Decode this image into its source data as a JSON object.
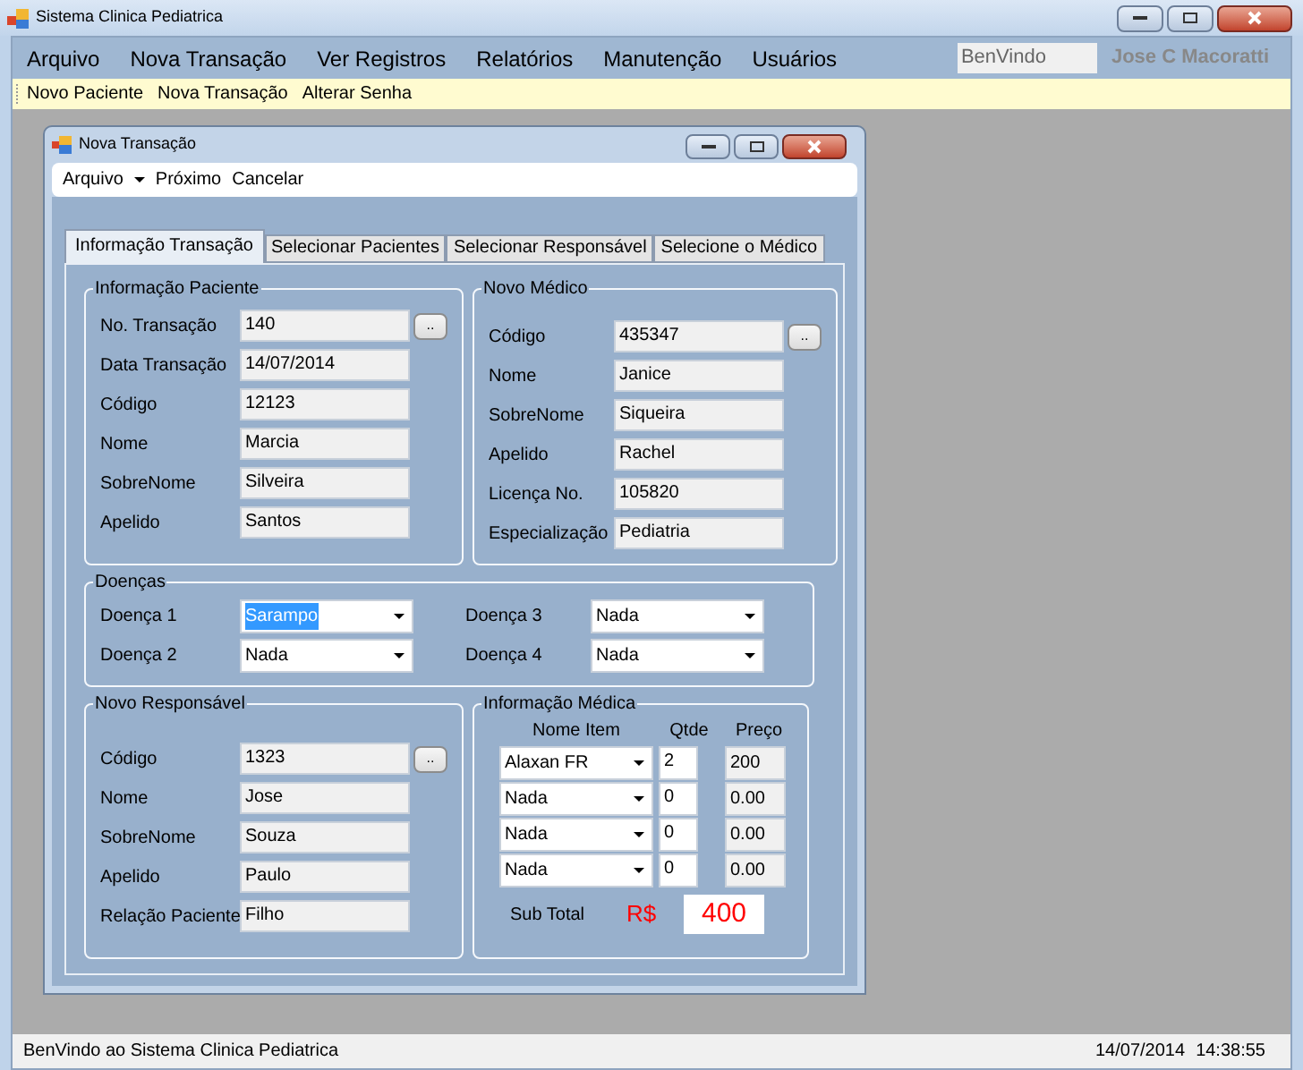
{
  "window": {
    "title": "Sistema Clinica Pediatrica"
  },
  "menu": [
    "Arquivo",
    "Nova Transação",
    "Ver Registros",
    "Relatórios",
    "Manutenção",
    "Usuários"
  ],
  "welcome_field": {
    "value": "BenVindo"
  },
  "user_name": "Jose C Macoratti",
  "toolbar": [
    "Novo Paciente",
    "Nova Transação",
    "Alterar Senha"
  ],
  "child_window": {
    "title": "Nova Transação",
    "menu": [
      {
        "label": "Arquivo",
        "kind": "dropdown"
      },
      {
        "label": "Próximo",
        "kind": "item"
      },
      {
        "label": "Cancelar",
        "kind": "item"
      }
    ],
    "tabs": [
      {
        "label": "Informação Transação",
        "selected": true
      },
      {
        "label": "Selecionar Pacientes",
        "selected": false
      },
      {
        "label": "Selecionar Responsável",
        "selected": false
      },
      {
        "label": "Selecione o Médico",
        "selected": false
      }
    ],
    "patient": {
      "title": "Informação Paciente",
      "fields": [
        {
          "label": "No. Transação",
          "value": "140",
          "lookup_button": ".."
        },
        {
          "label": "Data Transação",
          "value": "14/07/2014"
        },
        {
          "label": "Código",
          "value": "12123"
        },
        {
          "label": "Nome",
          "value": "Marcia"
        },
        {
          "label": "SobreNome",
          "value": "Silveira"
        },
        {
          "label": "Apelido",
          "value": "Santos"
        }
      ]
    },
    "doctor": {
      "title": "Novo Médico",
      "fields": [
        {
          "label": "Código",
          "value": "435347",
          "lookup_button": ".."
        },
        {
          "label": "Nome",
          "value": "Janice"
        },
        {
          "label": "SobreNome",
          "value": "Siqueira"
        },
        {
          "label": "Apelido",
          "value": "Rachel"
        },
        {
          "label": "Licença No.",
          "value": "105820"
        },
        {
          "label": "Especialização",
          "value": "Pediatria"
        }
      ]
    },
    "diseases": {
      "title": "Doenças",
      "fields": [
        {
          "label": "Doença 1",
          "value": "Sarampo",
          "highlighted": true
        },
        {
          "label": "Doença 2",
          "value": "Nada",
          "highlighted": false
        },
        {
          "label": "Doença 3",
          "value": "Nada",
          "highlighted": false
        },
        {
          "label": "Doença 4",
          "value": "Nada",
          "highlighted": false
        }
      ]
    },
    "guardian": {
      "title": "Novo Responsável",
      "fields": [
        {
          "label": "Código",
          "value": "1323",
          "lookup_button": ".."
        },
        {
          "label": "Nome",
          "value": "Jose"
        },
        {
          "label": "SobreNome",
          "value": "Souza"
        },
        {
          "label": "Apelido",
          "value": "Paulo"
        },
        {
          "label": "Relação Paciente",
          "value": "Filho"
        }
      ]
    },
    "medical": {
      "title": "Informação Médica",
      "columns": [
        "Nome Item",
        "Qtde",
        "Preço"
      ],
      "rows": [
        {
          "item": "Alaxan FR",
          "qty": "2",
          "price": "200"
        },
        {
          "item": "Nada",
          "qty": "0",
          "price": "0.00"
        },
        {
          "item": "Nada",
          "qty": "0",
          "price": "0.00"
        },
        {
          "item": "Nada",
          "qty": "0",
          "price": "0.00"
        }
      ],
      "subtotal_label": "Sub Total",
      "currency": "R$",
      "subtotal": "400"
    }
  },
  "status_bar": {
    "message": "BenVindo ao Sistema Clinica Pediatrica",
    "date": "14/07/2014",
    "time": "14:38:55"
  }
}
